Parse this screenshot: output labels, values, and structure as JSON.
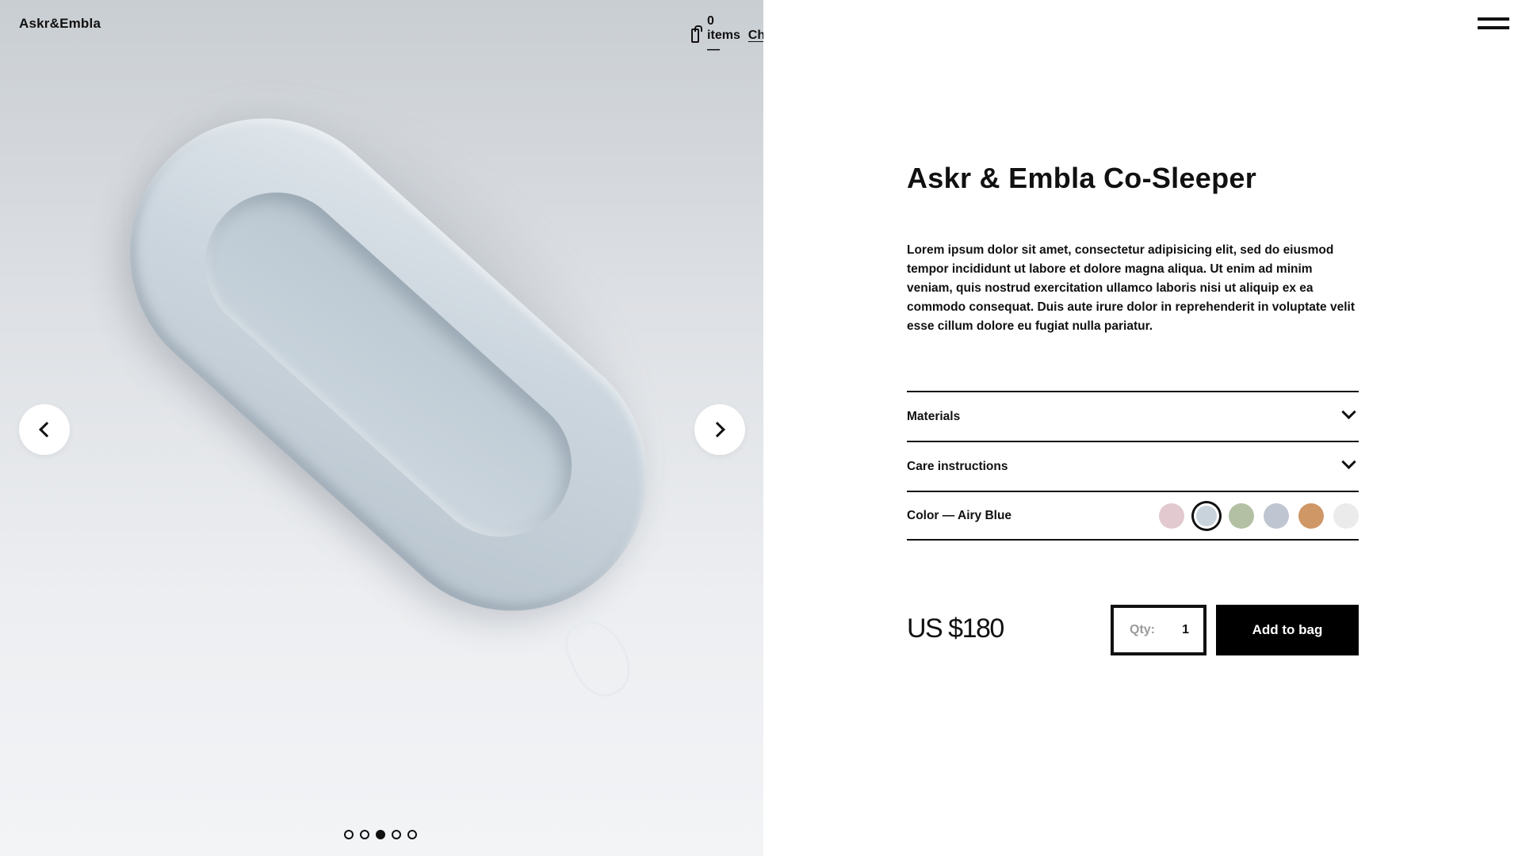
{
  "header": {
    "logo": "Askr&Embla",
    "cart": {
      "count_text": "0 items —",
      "checkout_label": "Checkout"
    }
  },
  "gallery": {
    "image_name": "co-sleeper-photo",
    "slides_total": 5,
    "active_slide": 3
  },
  "product": {
    "title": "Askr & Embla Co-Sleeper",
    "description": "Lorem ipsum dolor sit amet, consectetur adipisicing elit, sed do eiusmod tempor incididunt ut labore et dolore magna aliqua. Ut enim ad minim veniam, quis nostrud exercitation ullamco laboris nisi ut aliquip ex ea commodo consequat. Duis aute irure dolor in reprehenderit in voluptate velit esse cillum dolore eu fugiat nulla pariatur.",
    "accordion": {
      "materials_label": "Materials",
      "care_label": "Care instructions",
      "color_label": "Color — Airy Blue"
    },
    "colors": [
      {
        "name": "pink",
        "hex": "#e2c9cf"
      },
      {
        "name": "airy-blue",
        "hex": "#c9d3dc",
        "selected": true
      },
      {
        "name": "sage",
        "hex": "#b3c0a4"
      },
      {
        "name": "grey-blue",
        "hex": "#bfc6d2"
      },
      {
        "name": "caramel",
        "hex": "#cf9666"
      },
      {
        "name": "light-grey",
        "hex": "#ebebeb"
      }
    ],
    "price": "US $180",
    "qty_label": "Qty:",
    "qty_value": "1",
    "add_label": "Add to bag"
  }
}
